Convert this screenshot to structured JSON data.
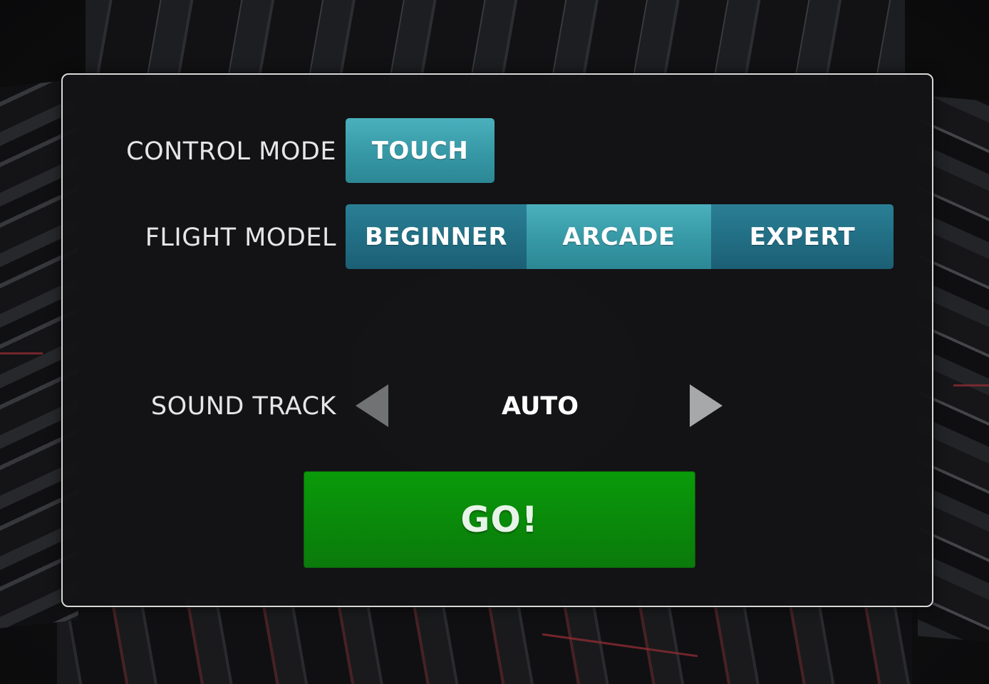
{
  "settings": {
    "control_mode": {
      "label": "CONTROL MODE",
      "options": [
        {
          "label": "TOUCH",
          "selected": true
        }
      ]
    },
    "flight_model": {
      "label": "FLIGHT MODEL",
      "options": [
        {
          "label": "BEGINNER",
          "selected": false
        },
        {
          "label": "ARCADE",
          "selected": true
        },
        {
          "label": "EXPERT",
          "selected": false
        }
      ]
    },
    "sound_track": {
      "label": "SOUND TRACK",
      "value": "AUTO",
      "prev_icon": "triangle-left-icon",
      "next_icon": "triangle-right-icon"
    }
  },
  "go_button": {
    "label": "GO!"
  },
  "colors": {
    "segment_active": "#389aa7",
    "segment_inactive": "#226f85",
    "go_button": "#0a8a0a",
    "panel_border": "#d9d9d9"
  }
}
